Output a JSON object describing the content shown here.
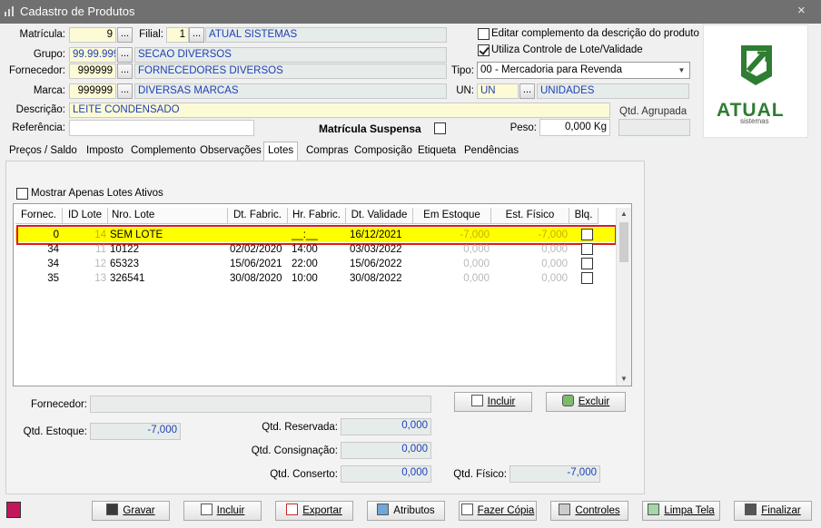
{
  "window": {
    "title": "Cadastro de Produtos",
    "close": "×"
  },
  "header": {
    "matricula_label": "Matrícula:",
    "matricula_value": "9",
    "filial_label": "Filial:",
    "filial_value": "1",
    "filial_name": "ATUAL SISTEMAS",
    "grupo_label": "Grupo:",
    "grupo_value": "99.99.999",
    "grupo_name": "SECAO  DIVERSOS",
    "fornecedor_label": "Fornecedor:",
    "fornecedor_value": "999999",
    "fornecedor_name": "FORNECEDORES DIVERSOS",
    "marca_label": "Marca:",
    "marca_value": "999999",
    "marca_name": "DIVERSAS MARCAS",
    "descricao_label": "Descrição:",
    "descricao_value": "LEITE CONDENSADO",
    "referencia_label": "Referência:",
    "referencia_value": "",
    "matricula_suspensa_label": "Matrícula Suspensa",
    "editar_complemento_label": "Editar complemento da descrição do produto",
    "controle_lote_label": "Utiliza Controle de Lote/Validade",
    "tipo_label": "Tipo:",
    "tipo_value": "00 - Mercadoria para Revenda",
    "un_label": "UN:",
    "un_value": "UN",
    "un_name": "UNIDADES",
    "qtd_agrupada_label": "Qtd. Agrupada",
    "peso_label": "Peso:",
    "peso_value": "0,000 Kg",
    "dots": "..."
  },
  "logo": {
    "text": "ATUAL",
    "subtext": "sistemas",
    "color": "#2e7d32"
  },
  "tabs": [
    "Preços / Saldo",
    "Imposto",
    "Complemento",
    "Observações",
    "Lotes",
    "Compras",
    "Composição",
    "Etiqueta",
    "Pendências"
  ],
  "lotes": {
    "mostrar_ativos_label": "Mostrar Apenas Lotes Ativos",
    "columns": [
      "Fornec.",
      "ID Lote",
      "Nro. Lote",
      "Dt. Fabric.",
      "Hr. Fabric.",
      "Dt. Validade",
      "Em Estoque",
      "Est. Físico",
      "Blq."
    ],
    "rows": [
      {
        "fornec": "0",
        "id": "14",
        "nro": "SEM LOTE",
        "dt_fab": "",
        "hr_fab": "__:__",
        "validade": "16/12/2021",
        "estoque": "-7,000",
        "fisico": "-7,000"
      },
      {
        "fornec": "34",
        "id": "11",
        "nro": "10122",
        "dt_fab": "02/02/2020",
        "hr_fab": "14:00",
        "validade": "03/03/2022",
        "estoque": "0,000",
        "fisico": "0,000"
      },
      {
        "fornec": "34",
        "id": "12",
        "nro": "65323",
        "dt_fab": "15/06/2021",
        "hr_fab": "22:00",
        "validade": "15/06/2022",
        "estoque": "0,000",
        "fisico": "0,000"
      },
      {
        "fornec": "35",
        "id": "13",
        "nro": "326541",
        "dt_fab": "30/08/2020",
        "hr_fab": "10:00",
        "validade": "30/08/2022",
        "estoque": "0,000",
        "fisico": "0,000"
      }
    ],
    "fornecedor_label": "Fornecedor:",
    "incluir_label": "Incluir",
    "excluir_label": "Excluir",
    "qtd_estoque_label": "Qtd. Estoque:",
    "qtd_estoque_value": "-7,000",
    "qtd_reservada_label": "Qtd. Reservada:",
    "qtd_reservada_value": "0,000",
    "qtd_consignacao_label": "Qtd. Consignação:",
    "qtd_consignacao_value": "0,000",
    "qtd_conserto_label": "Qtd. Conserto:",
    "qtd_conserto_value": "0,000",
    "qtd_fisico_label": "Qtd. Físico:",
    "qtd_fisico_value": "-7,000"
  },
  "footer": [
    "Gravar",
    "Incluir",
    "Exportar",
    "Atributos",
    "Fazer Cópia",
    "Controles",
    "Limpa Tela",
    "Finalizar"
  ],
  "colors": {
    "highlight_row": "#ffff00",
    "highlight_border": "#e0191b",
    "input_bg": "#fdfbd6"
  }
}
